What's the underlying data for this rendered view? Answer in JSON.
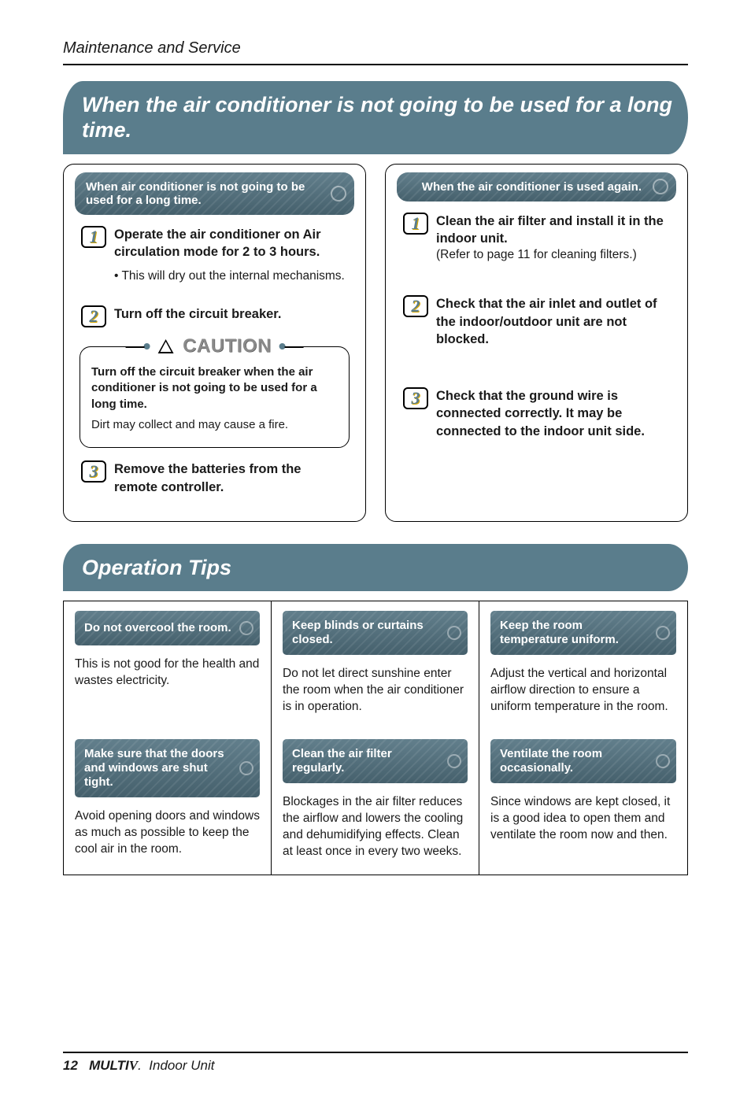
{
  "header": {
    "section": "Maintenance and Service"
  },
  "title1": "When the air conditioner is not going to be used for a long time.",
  "leftPanel": {
    "caption": "When air conditioner is not going to be used for a long time.",
    "step1_bold": "Operate the air conditioner on Air circulation mode for 2 to 3 hours.",
    "step1_sub": "This will dry out the internal mechanisms.",
    "step2_bold": "Turn off the circuit breaker.",
    "caution_label": "CAUTION",
    "caution_bold": "Turn off the circuit breaker when the air conditioner is not going to be used for a long time.",
    "caution_body": "Dirt may collect and may cause a fire.",
    "step3_bold": "Remove the batteries from the remote controller."
  },
  "rightPanel": {
    "caption": "When the air conditioner is used again.",
    "step1_bold": "Clean the air filter and install it in the indoor unit.",
    "step1_paren": "(Refer to page 11 for cleaning filters.)",
    "step2_bold": "Check that the air inlet and outlet of the indoor/outdoor unit are not blocked.",
    "step3_bold": "Check that the ground wire is connected correctly. It may be connected to the indoor unit side."
  },
  "title2": "Operation Tips",
  "tips": {
    "r1c1_cap": "Do not overcool the room.",
    "r1c1_body": "This is not good for the health and wastes electricity.",
    "r1c2_cap": "Keep blinds or curtains closed.",
    "r1c2_body": "Do not let direct sunshine enter the room when the air conditioner is in operation.",
    "r1c3_cap": "Keep the room temperature uniform.",
    "r1c3_body": "Adjust the vertical and horizontal airflow direction to ensure a uniform temperature in the room.",
    "r2c1_cap": "Make sure that the doors and windows are shut tight.",
    "r2c1_body": "Avoid opening doors and windows as much as possible to keep the cool air in the room.",
    "r2c2_cap": "Clean the air filter regularly.",
    "r2c2_body": "Blockages in the air filter reduces the airflow and lowers the cooling and dehumidifying effects. Clean at least once in every two weeks.",
    "r2c3_cap": "Ventilate the room occasionally.",
    "r2c3_body": "Since windows are kept closed, it is a good idea to open them and ventilate the room now and then."
  },
  "footer": {
    "page": "12",
    "brand": "MULTI",
    "brandV": "V",
    "brandDot": ".",
    "tail": "Indoor Unit"
  },
  "digits": {
    "d1": "1",
    "d2": "2",
    "d3": "3"
  }
}
